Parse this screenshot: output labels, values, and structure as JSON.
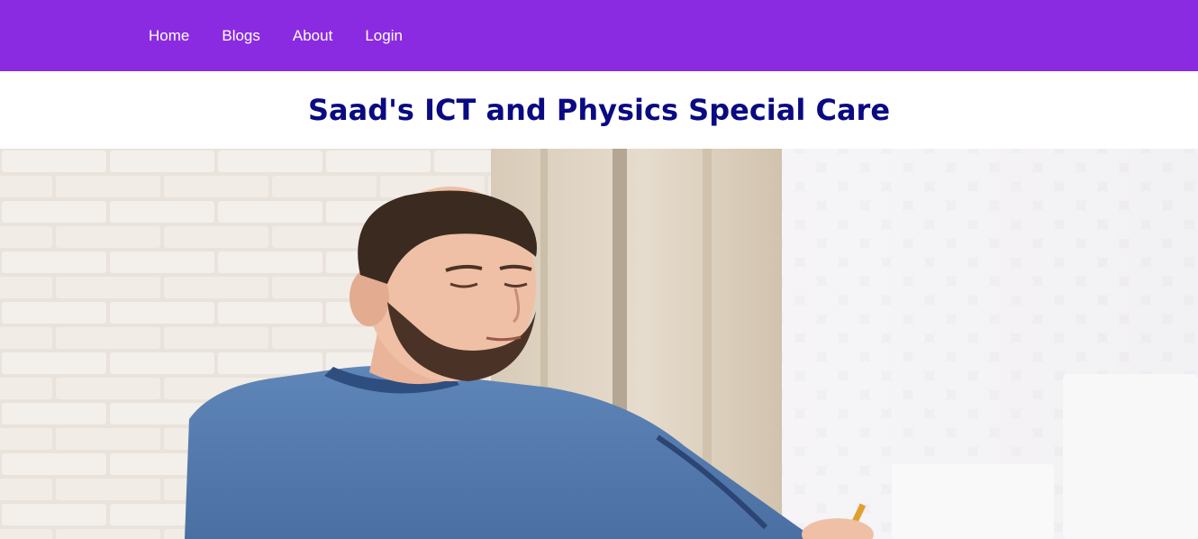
{
  "nav": {
    "items": [
      {
        "label": "Home"
      },
      {
        "label": "Blogs"
      },
      {
        "label": "About"
      },
      {
        "label": "Login"
      }
    ],
    "background": "#8a2be2",
    "text_color": "#ffffff"
  },
  "header": {
    "title": "Saad's ICT and Physics Special Care",
    "title_color": "#0a0a82"
  },
  "hero": {
    "image_icon": "man-studying-photo"
  }
}
